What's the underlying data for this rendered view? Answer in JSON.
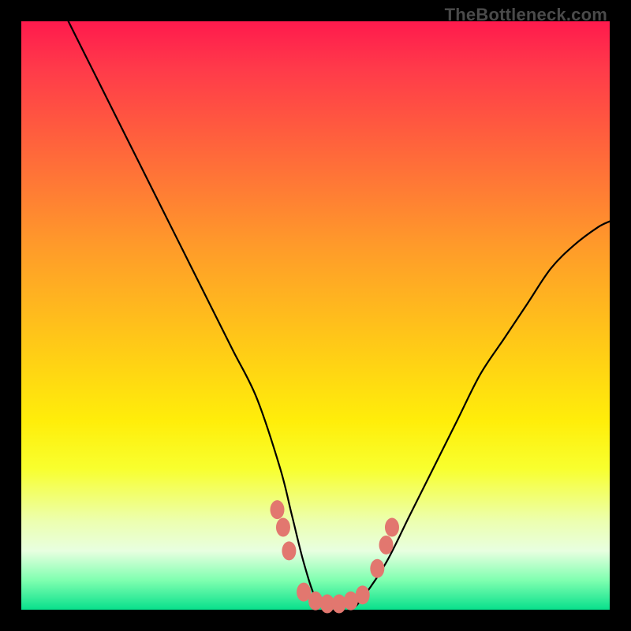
{
  "watermark": "TheBottleneck.com",
  "colors": {
    "frame": "#000000",
    "gradient_top": "#ff1a4d",
    "gradient_bottom": "#08e08c",
    "curve": "#000000",
    "dots": "#e2776f"
  },
  "chart_data": {
    "type": "line",
    "title": "",
    "xlabel": "",
    "ylabel": "",
    "xlim": [
      0,
      100
    ],
    "ylim": [
      0,
      100
    ],
    "series": [
      {
        "name": "bottleneck-curve",
        "x": [
          8,
          12,
          16,
          20,
          24,
          28,
          32,
          36,
          40,
          44,
          46,
          48,
          50,
          52,
          54,
          56,
          58,
          62,
          66,
          70,
          74,
          78,
          82,
          86,
          90,
          94,
          98,
          100
        ],
        "y": [
          100,
          92,
          84,
          76,
          68,
          60,
          52,
          44,
          36,
          24,
          16,
          8,
          2,
          0,
          0,
          0,
          2,
          8,
          16,
          24,
          32,
          40,
          46,
          52,
          58,
          62,
          65,
          66
        ]
      }
    ],
    "scatter": [
      {
        "x": 43.5,
        "y": 17
      },
      {
        "x": 44.5,
        "y": 14
      },
      {
        "x": 45.5,
        "y": 10
      },
      {
        "x": 48.0,
        "y": 3
      },
      {
        "x": 50.0,
        "y": 1.5
      },
      {
        "x": 52.0,
        "y": 1
      },
      {
        "x": 54.0,
        "y": 1
      },
      {
        "x": 56.0,
        "y": 1.5
      },
      {
        "x": 58.0,
        "y": 2.5
      },
      {
        "x": 60.5,
        "y": 7
      },
      {
        "x": 62.0,
        "y": 11
      },
      {
        "x": 63.0,
        "y": 14
      }
    ]
  }
}
